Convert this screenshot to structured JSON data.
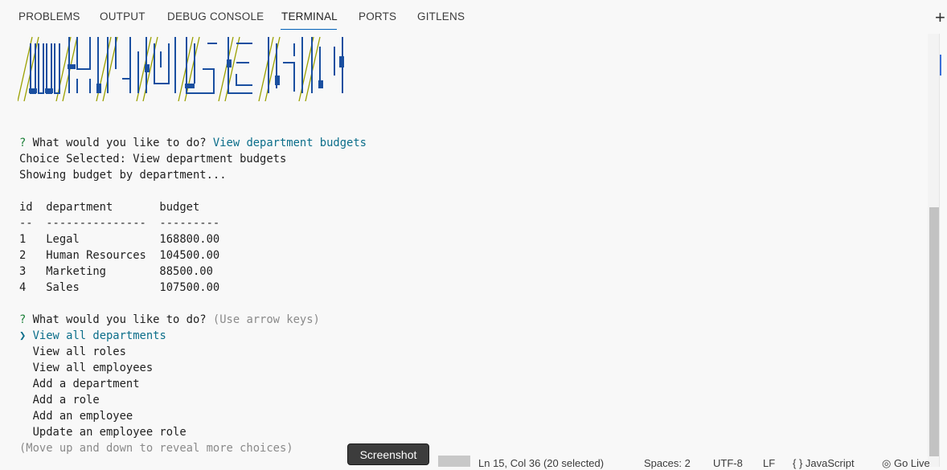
{
  "panel": {
    "tabs": [
      "PROBLEMS",
      "OUTPUT",
      "DEBUG CONSOLE",
      "TERMINAL",
      "PORTS",
      "GITLENS"
    ],
    "active_tab": "TERMINAL",
    "add_icon": "plus-icon"
  },
  "banner": {
    "art": "ascii-art-banner"
  },
  "terminal": {
    "q1_mark": "?",
    "q1_text": " What would you like to do? ",
    "q1_answer": "View department budgets",
    "choice_line": "Choice Selected: View department budgets",
    "showing_line": "Showing budget by department...",
    "table_header": "id  department       budget",
    "table_sep": "--  ---------------  ---------",
    "rows": [
      "1   Legal            168800.00",
      "2   Human Resources  104500.00",
      "3   Marketing        88500.00",
      "4   Sales            107500.00"
    ],
    "q2_mark": "?",
    "q2_text": " What would you like to do? ",
    "q2_hint": "(Use arrow keys)",
    "pointer": "❯ ",
    "selected_option": "View all departments",
    "options": [
      "  View all roles",
      "  View all employees",
      "  Add a department",
      "  Add a role",
      "  Add an employee",
      "  Update an employee role"
    ],
    "more_hint": "(Move up and down to reveal more choices)"
  },
  "statusbar": {
    "position": "Ln 15, Col 36 (20 selected)",
    "spaces": "Spaces: 2",
    "encoding": "UTF-8",
    "eol": "LF",
    "language": "{ }  JavaScript",
    "golive": "◎ Go Live"
  },
  "tooltip": {
    "label": "Screenshot"
  },
  "colors": {
    "accent": "#005fb8",
    "prompt_green": "#1a7f37",
    "answer_teal": "#0b6e8a"
  }
}
